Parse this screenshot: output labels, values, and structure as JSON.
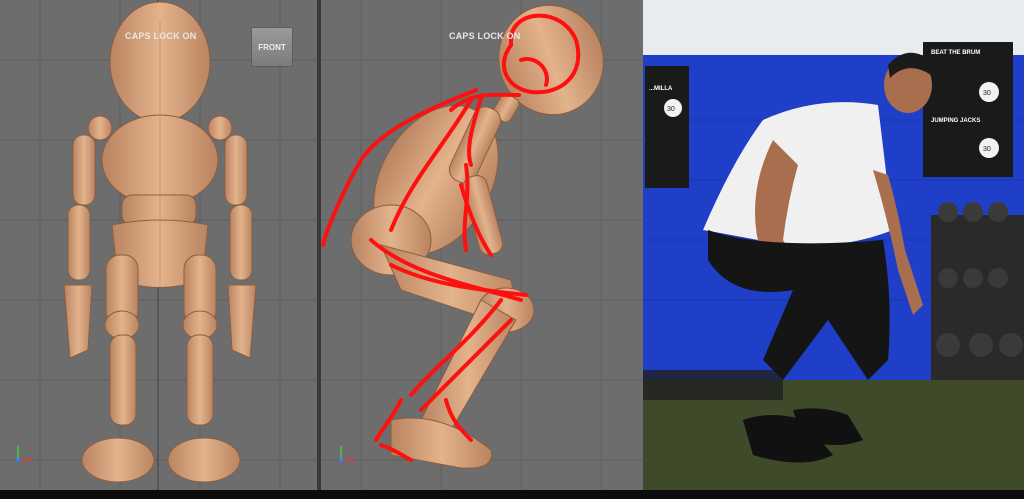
{
  "viewports": {
    "left": {
      "overlay_label": "CAPS LOCK ON",
      "view_button_label": "FRONT"
    },
    "middle": {
      "overlay_label": "CAPS LOCK ON"
    }
  },
  "reference_photo": {
    "poster_left": {
      "title": "...MILLA",
      "timer": "30"
    },
    "poster_right": {
      "title": "BEAT THE BRUM",
      "subtitle": "JUMPING JACKS",
      "timers": [
        "30",
        "30"
      ]
    }
  },
  "colors": {
    "viewport_bg": "#6d6d6d",
    "model_skin": "#d9a77f",
    "sketch_red": "#ff1010",
    "wall_blue": "#1f3fc8",
    "floor_green": "#3f4a2a"
  },
  "icons": [
    "axis-gizmo-icon",
    "front-view-cube-icon"
  ]
}
